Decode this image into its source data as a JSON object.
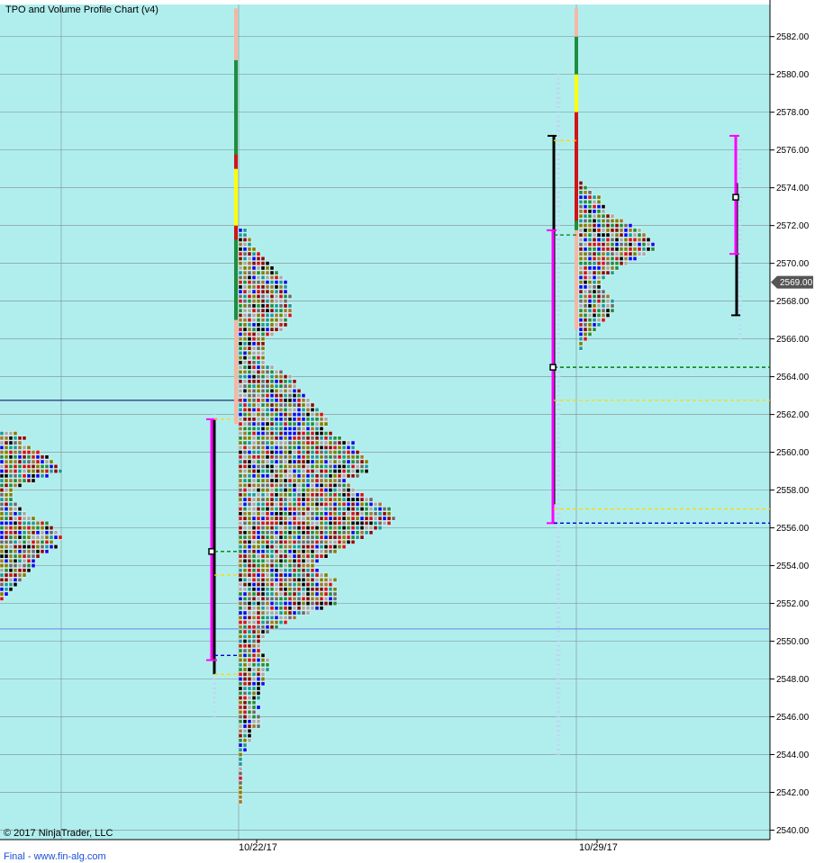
{
  "chart": {
    "title": "TPO and Volume Profile Chart (v4)",
    "copyright": "© 2017 NinjaTrader, LLC",
    "footer": "Final - www.fin-alg.com"
  },
  "colors": {
    "background": "#b0eeee",
    "grid": "#8a9a9a",
    "tpo_palette": [
      "#d0141a",
      "#1e8e3e",
      "#0a0aee",
      "#6b6b6b",
      "#9b7b2f",
      "#000000",
      "#8b0a0a",
      "#1a9a9a",
      "#a9a9a9",
      "#7f7f00"
    ],
    "volume": "#c8c8f0",
    "value_area": "#ff00ff",
    "range_bar": "#000000",
    "poc_line": "#008000",
    "vah_line": "#ffd700",
    "val_line": "#0000cc",
    "last_price_badge": "#555555",
    "initial_balance": "#1e8e3e",
    "opening_range": "#ffff00",
    "session_extension": "#d0141a",
    "tail": "#f5b7a3"
  },
  "chart_data": {
    "type": "tpo_profile",
    "y_axis": {
      "ylim": [
        2539.5,
        2583.7
      ],
      "ticks": [
        "2540.00",
        "2542.00",
        "2544.00",
        "2546.00",
        "2548.00",
        "2550.00",
        "2552.00",
        "2554.00",
        "2556.00",
        "2558.00",
        "2560.00",
        "2562.00",
        "2564.00",
        "2566.00",
        "2568.00",
        "2570.00",
        "2572.00",
        "2574.00",
        "2576.00",
        "2578.00",
        "2580.00",
        "2582.00"
      ]
    },
    "x_axis": {
      "labels": [
        "10/22/17",
        "10/29/17"
      ]
    },
    "last_price": "2569.00",
    "horizontal_levels": [
      2562.75,
      2550.65
    ],
    "profiles": [
      {
        "session": "week before 10/22/17",
        "low": 2552.25,
        "high": 2561.0,
        "poc": 2554.75,
        "vah": 2553.5,
        "val": 2549.25,
        "range_low": 2548.25,
        "range_high": 2561.75,
        "value_area": [
          2549.0,
          2561.75
        ],
        "widths": [
          1,
          2,
          3,
          4,
          5,
          6,
          7,
          8,
          8,
          9,
          11,
          13,
          12,
          14,
          13,
          12,
          11,
          8,
          6,
          5,
          4,
          3,
          3,
          3,
          5,
          8,
          11,
          14,
          13,
          12,
          11,
          9,
          7,
          5,
          6,
          4
        ]
      },
      {
        "session": "10/22/17",
        "low": 2541.5,
        "high": 2579.5,
        "poc": 2564.5,
        "vah": 2561.75,
        "val": 2556.75,
        "value_area": [
          2556.5,
          2571.5
        ],
        "widths": [
          1,
          1,
          1,
          1,
          1,
          1,
          1,
          1,
          1,
          1,
          1,
          2,
          2,
          3,
          3,
          3,
          5,
          5,
          5,
          4,
          5,
          4,
          5,
          5,
          5,
          6,
          6,
          6,
          7,
          7,
          7,
          6,
          5,
          5,
          5,
          6,
          7,
          9,
          11,
          13,
          16,
          19,
          22,
          22,
          22,
          22,
          21,
          22,
          20,
          18,
          17,
          18,
          20,
          22,
          24,
          26,
          28,
          30,
          32,
          34,
          35,
          34,
          34,
          32,
          30,
          28,
          26,
          25,
          24,
          27,
          29,
          29,
          29,
          28,
          27,
          26,
          26,
          23,
          21,
          19,
          20,
          20,
          19,
          18,
          17,
          16,
          15,
          14,
          13,
          13,
          12,
          10,
          8,
          6,
          6,
          6,
          6,
          6,
          6,
          8,
          10,
          11,
          11,
          12,
          12,
          12,
          11,
          12,
          11,
          11,
          11,
          10,
          9,
          8,
          7,
          6,
          5,
          4,
          3,
          3,
          2,
          2
        ],
        "tail_top": 2583.5,
        "ib_low": 2567.0,
        "ib_high": 2580.75,
        "or_low": 2572.0,
        "or_high": 2575.0,
        "ext_low": 2571.25,
        "ext_high": 2575.75
      },
      {
        "session": "10/29/17",
        "low": 2565.5,
        "high": 2577.25,
        "poc": 2564.5,
        "vah": 2576.5,
        "val": 2571.5,
        "range_low": 2557.25,
        "range_high": 2576.75,
        "value_area": [
          2556.25,
          2571.75
        ],
        "widths": [
          1,
          1,
          2,
          3,
          4,
          5,
          6,
          7,
          8,
          8,
          8,
          7,
          6,
          5,
          5,
          6,
          8,
          9,
          11,
          13,
          15,
          17,
          17,
          16,
          15,
          14,
          12,
          10,
          8,
          6,
          6,
          5,
          5,
          3,
          2,
          1
        ],
        "tail_top": 2583.5,
        "ib_low": 2571.75,
        "ib_high": 2582.0,
        "or_low": 2578.0,
        "or_high": 2580.0,
        "ext_low": 2572.25,
        "ext_high": 2578.0
      },
      {
        "session": "current",
        "range_low": 2567.25,
        "range_high": 2574.25,
        "value_area": [
          2570.5,
          2576.75
        ],
        "poc": 2573.5
      }
    ]
  }
}
